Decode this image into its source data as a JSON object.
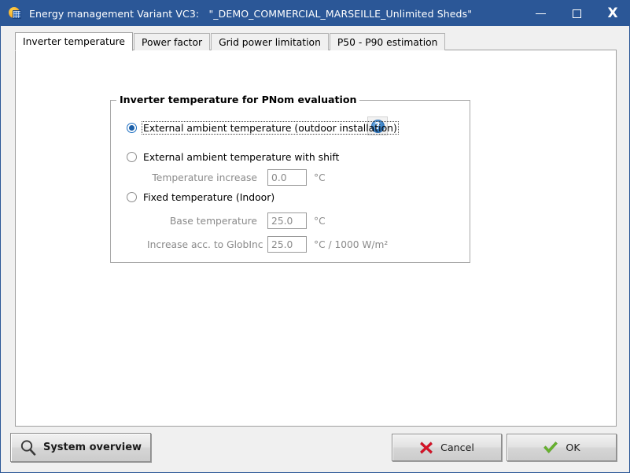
{
  "window": {
    "title_prefix": "Energy management Variant VC3:",
    "title_variant": "\"_DEMO_COMMERCIAL_MARSEILLE_Unlimited Sheds\"",
    "app_icon": "pvsyst-sun-panel-icon",
    "controls": {
      "minimize": "minimize-icon",
      "maximize": "maximize-icon",
      "close": "X"
    },
    "accent_color": "#2b5797",
    "content_bg": "#ffffff",
    "chrome_bg": "#f0f0f0"
  },
  "tabs": [
    {
      "label": "Inverter temperature",
      "active": true
    },
    {
      "label": "Power factor",
      "active": false
    },
    {
      "label": "Grid power limitation",
      "active": false
    },
    {
      "label": "P50 - P90 estimation",
      "active": false
    }
  ],
  "groupbox": {
    "title": "Inverter temperature for PNom evaluation",
    "help_icon": "help-question-icon",
    "help_glyph": "?",
    "options": [
      {
        "label": "External ambient temperature (outdoor installation)",
        "selected": true,
        "focused": true
      },
      {
        "label": "External ambient temperature with shift",
        "selected": false,
        "focused": false
      },
      {
        "label": "Fixed temperature (Indoor)",
        "selected": false,
        "focused": false
      }
    ],
    "fields": [
      {
        "label": "Temperature increase",
        "value": "0.0",
        "placeholder": "0.0",
        "unit": "°C"
      },
      {
        "label": "Base temperature",
        "value": "25.0",
        "placeholder": "25.0",
        "unit": "°C"
      },
      {
        "label": "Increase acc. to GlobInc",
        "value": "25.0",
        "placeholder": "25.0",
        "unit": "°C / 1000 W/m²"
      }
    ]
  },
  "footer": {
    "system_overview": {
      "label": "System overview",
      "icon": "magnifier-icon"
    },
    "cancel": {
      "label": "Cancel",
      "icon": "red-x-icon",
      "color": "#d81226"
    },
    "ok": {
      "label": "OK",
      "icon": "green-check-icon",
      "color": "#67b32e"
    }
  }
}
